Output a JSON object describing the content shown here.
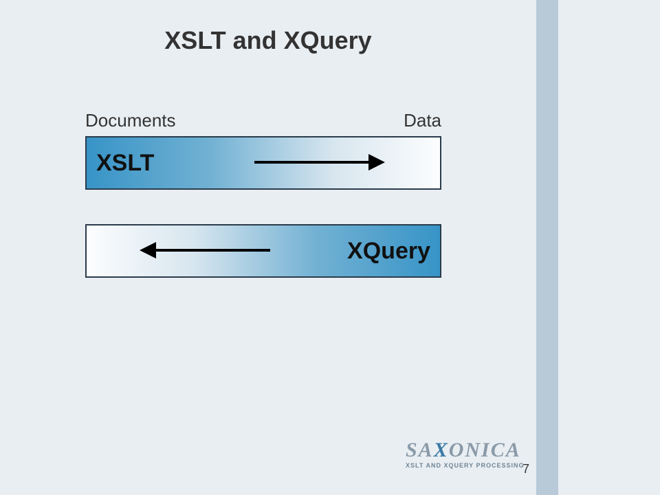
{
  "slide": {
    "title": "XSLT and XQuery",
    "labels": {
      "left": "Documents",
      "right": "Data"
    },
    "box1": {
      "text": "XSLT",
      "arrow_direction": "right"
    },
    "box2": {
      "text": "XQuery",
      "arrow_direction": "left"
    },
    "page_number": "7"
  },
  "logo": {
    "name_part1": "SA",
    "name_x": "X",
    "name_part2": "ONICA",
    "subtitle": "XSLT AND XQUERY PROCESSING"
  }
}
